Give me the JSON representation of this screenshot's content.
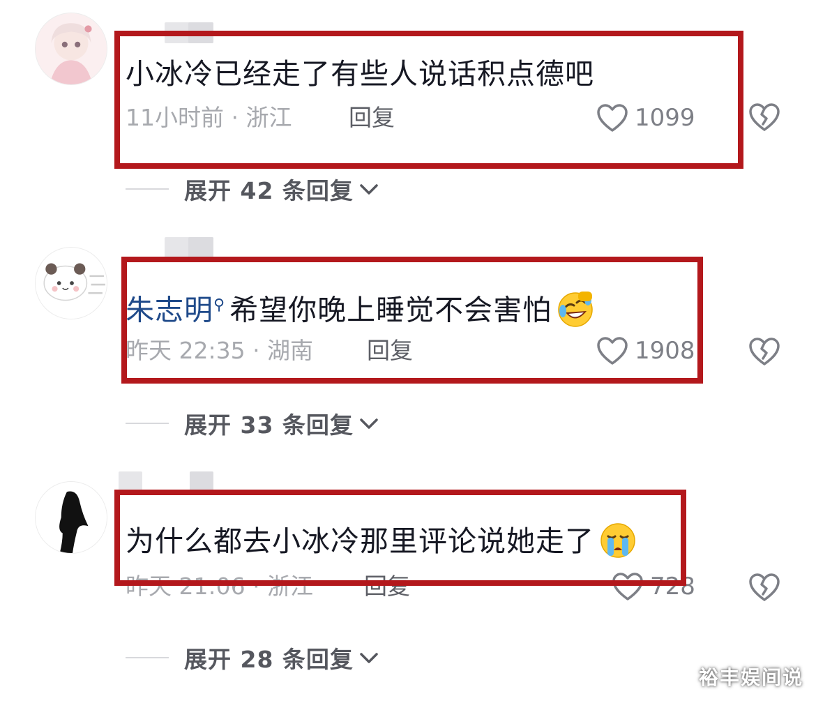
{
  "comments": [
    {
      "text": "小冰冷已经走了有些人说话积点德吧",
      "meta": "11小时前 · 浙江",
      "reply_label": "回复",
      "likes": "1099",
      "expand_label": "展开 42 条回复"
    },
    {
      "mention": "朱志明",
      "text": "希望你晚上睡觉不会害怕",
      "meta": "昨天 22:35 · 湖南",
      "reply_label": "回复",
      "likes": "1908",
      "expand_label": "展开 33 条回复",
      "emoji": "rolling-laughing-emoji"
    },
    {
      "text": "为什么都去小冰冷那里评论说她走了",
      "meta": "昨天 21:06 · 浙江",
      "reply_label": "回复",
      "likes": "728",
      "expand_label": "展开 28 条回复",
      "emoji": "crying-emoji"
    }
  ],
  "icons": {
    "like": "heart-outline-icon",
    "dislike": "broken-heart-icon",
    "expand": "chevron-down-icon",
    "mention": "search-icon"
  },
  "colors": {
    "highlight_border": "#b3181c",
    "mention_text": "#1f4a8a",
    "meta_text": "#a7a9ae"
  },
  "watermark": "裕丰娱间说"
}
